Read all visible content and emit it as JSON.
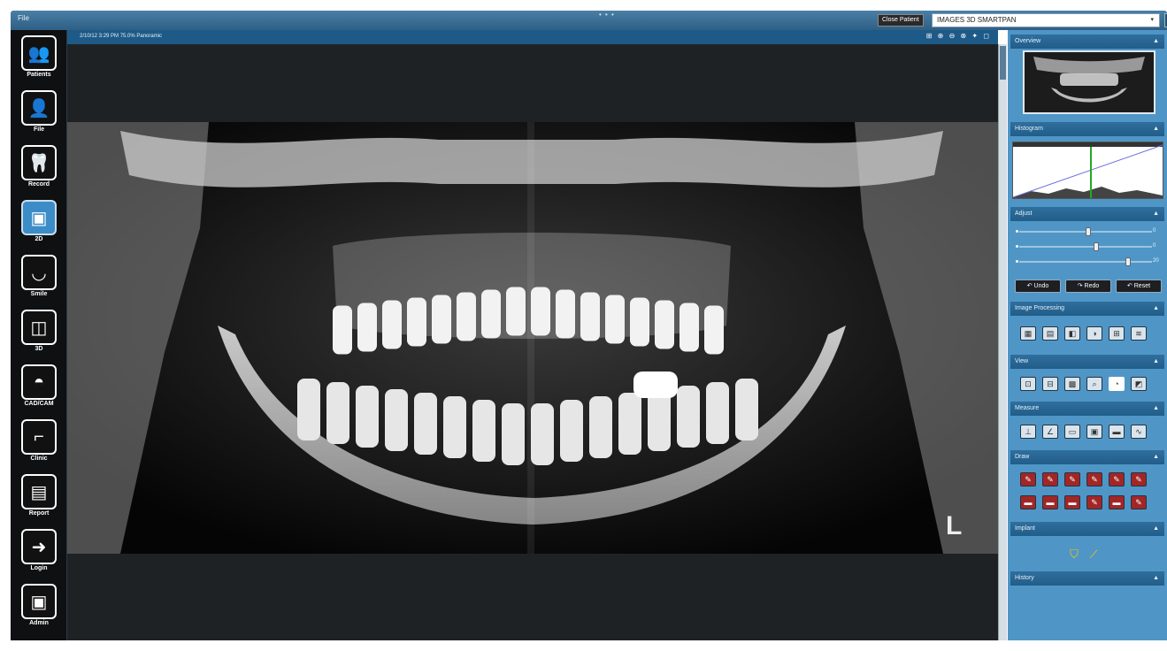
{
  "menu": {
    "file": "File"
  },
  "titlebar": {
    "dots": "• • •",
    "close_patient": "Close Patient",
    "patient": "IMAGES 3D SMARTPAN",
    "chevron": "▾",
    "action": "☰"
  },
  "nav": [
    {
      "label": "Patients",
      "icon": "patients-icon",
      "glyph": "👥"
    },
    {
      "label": "File",
      "icon": "person-icon",
      "glyph": "👤"
    },
    {
      "label": "Record",
      "icon": "tooth-icon",
      "glyph": "🦷"
    },
    {
      "label": "2D",
      "icon": "2d-imaging-icon",
      "glyph": "▣",
      "active": true
    },
    {
      "label": "Smile",
      "icon": "smile-icon",
      "glyph": "◡"
    },
    {
      "label": "3D",
      "icon": "cube-icon",
      "glyph": "◫"
    },
    {
      "label": "CAD/CAM",
      "icon": "crown-icon",
      "glyph": "◓"
    },
    {
      "label": "Clinic",
      "icon": "dental-chair-icon",
      "glyph": "⌐"
    },
    {
      "label": "Report",
      "icon": "report-icon",
      "glyph": "▤"
    },
    {
      "label": "Login",
      "icon": "login-arrow-icon",
      "glyph": "➜"
    },
    {
      "label": "Admin",
      "icon": "admin-icon",
      "glyph": "▣"
    }
  ],
  "viewer": {
    "info": "2/10/12 3:29 PM  75.0%  Panoramic",
    "tools": "⊞ ⊕ ⊖ ⊗ ✦ ◻",
    "marker": "L"
  },
  "panel": {
    "overview": "Overview",
    "histogram": "Histogram",
    "adjust": "Adjust",
    "sliders": [
      {
        "value": 0.52,
        "label": "0"
      },
      {
        "value": 0.58,
        "label": "0"
      },
      {
        "value": 0.82,
        "label": "20"
      }
    ],
    "undo": "↶ Undo",
    "redo": "↷ Redo",
    "reset": "↶ Reset",
    "image_processing": "Image Processing",
    "view": "View",
    "measure": "Measure",
    "draw": "Draw",
    "implant": "Implant",
    "history": "History",
    "caret": "▲"
  },
  "colors": {
    "accent": "#4f96c6",
    "header": "#215d89",
    "nav_active": "#3b8cc7",
    "histogram_line": "#22aa22"
  }
}
